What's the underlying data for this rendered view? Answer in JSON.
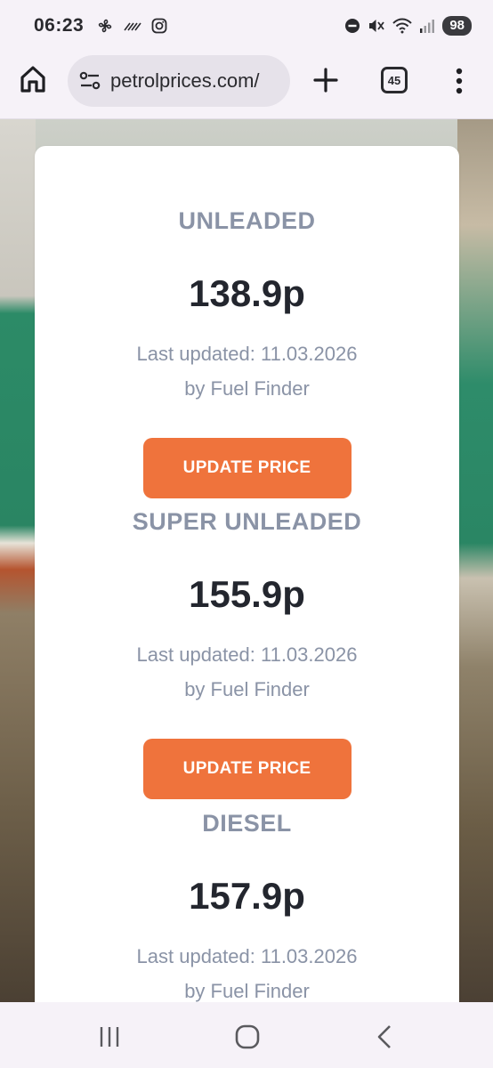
{
  "status_bar": {
    "time": "06:23",
    "battery": "98"
  },
  "browser": {
    "url": "petrolprices.com/",
    "tab_count": "45"
  },
  "fuels": [
    {
      "name": "UNLEADED",
      "price": "138.9p",
      "updated": "Last updated: 11.03.2026",
      "source": "by Fuel Finder",
      "button": "UPDATE PRICE"
    },
    {
      "name": "SUPER UNLEADED",
      "price": "155.9p",
      "updated": "Last updated: 11.03.2026",
      "source": "by Fuel Finder",
      "button": "UPDATE PRICE"
    },
    {
      "name": "DIESEL",
      "price": "157.9p",
      "updated": "Last updated: 11.03.2026",
      "source": "by Fuel Finder"
    }
  ],
  "colors": {
    "accent_button": "#ef733c",
    "fuel_label": "#8a93a6",
    "price_text": "#23262e"
  },
  "icons": {
    "status_left": [
      "fan-icon",
      "signal-slash-icon",
      "instagram-icon"
    ],
    "status_right": [
      "do-not-disturb-icon",
      "mute-icon",
      "wifi-icon",
      "cell-signal-icon"
    ],
    "toolbar": [
      "home-icon",
      "site-settings-icon",
      "plus-icon",
      "tab-switcher-icon",
      "more-vert-icon"
    ],
    "nav": [
      "recents-icon",
      "home-nav-icon",
      "back-icon"
    ]
  }
}
